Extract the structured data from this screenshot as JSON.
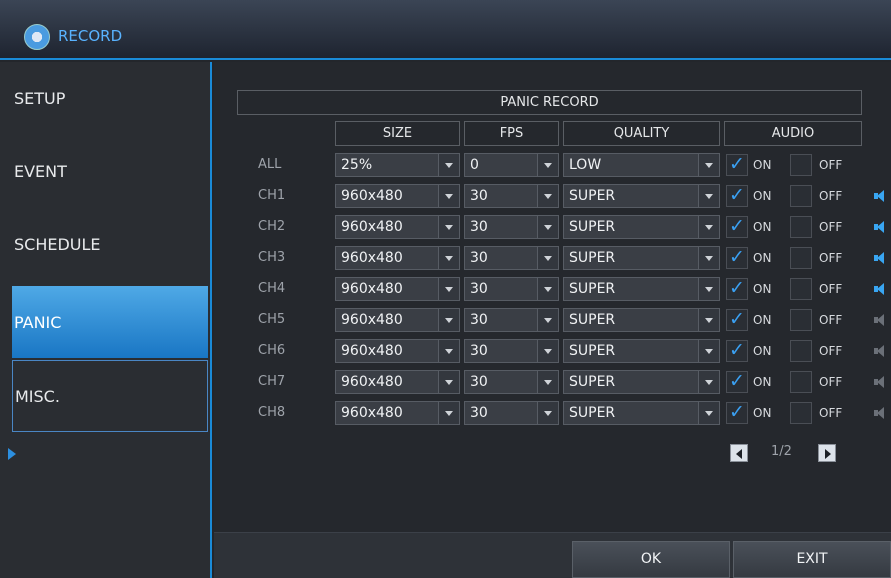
{
  "window": {
    "title": "RECORD"
  },
  "sidebar": {
    "items": [
      {
        "label": "SETUP"
      },
      {
        "label": "EVENT"
      },
      {
        "label": "SCHEDULE"
      },
      {
        "label": "PANIC"
      },
      {
        "label": "MISC."
      }
    ],
    "selected": "PANIC"
  },
  "panel": {
    "title": "PANIC RECORD",
    "headers": {
      "size": "SIZE",
      "fps": "FPS",
      "quality": "QUALITY",
      "audio": "AUDIO"
    },
    "on_label": "ON",
    "off_label": "OFF",
    "rows": [
      {
        "label": "ALL",
        "size": "25%",
        "fps": "0",
        "quality": "LOW",
        "on": true,
        "off": false,
        "speaker": "none"
      },
      {
        "label": "CH1",
        "size": "960x480",
        "fps": "30",
        "quality": "SUPER",
        "on": true,
        "off": false,
        "speaker": "active"
      },
      {
        "label": "CH2",
        "size": "960x480",
        "fps": "30",
        "quality": "SUPER",
        "on": true,
        "off": false,
        "speaker": "active"
      },
      {
        "label": "CH3",
        "size": "960x480",
        "fps": "30",
        "quality": "SUPER",
        "on": true,
        "off": false,
        "speaker": "active"
      },
      {
        "label": "CH4",
        "size": "960x480",
        "fps": "30",
        "quality": "SUPER",
        "on": true,
        "off": false,
        "speaker": "active"
      },
      {
        "label": "CH5",
        "size": "960x480",
        "fps": "30",
        "quality": "SUPER",
        "on": true,
        "off": false,
        "speaker": "inactive"
      },
      {
        "label": "CH6",
        "size": "960x480",
        "fps": "30",
        "quality": "SUPER",
        "on": true,
        "off": false,
        "speaker": "inactive"
      },
      {
        "label": "CH7",
        "size": "960x480",
        "fps": "30",
        "quality": "SUPER",
        "on": true,
        "off": false,
        "speaker": "inactive"
      },
      {
        "label": "CH8",
        "size": "960x480",
        "fps": "30",
        "quality": "SUPER",
        "on": true,
        "off": false,
        "speaker": "inactive"
      }
    ],
    "pager": {
      "text": "1/2"
    }
  },
  "buttons": {
    "ok": "OK",
    "exit": "EXIT"
  },
  "colors": {
    "accent": "#1a8bd8",
    "selected": "#2f8fdc",
    "speaker_active": "#39a6f2",
    "speaker_inactive": "#6b7078"
  }
}
